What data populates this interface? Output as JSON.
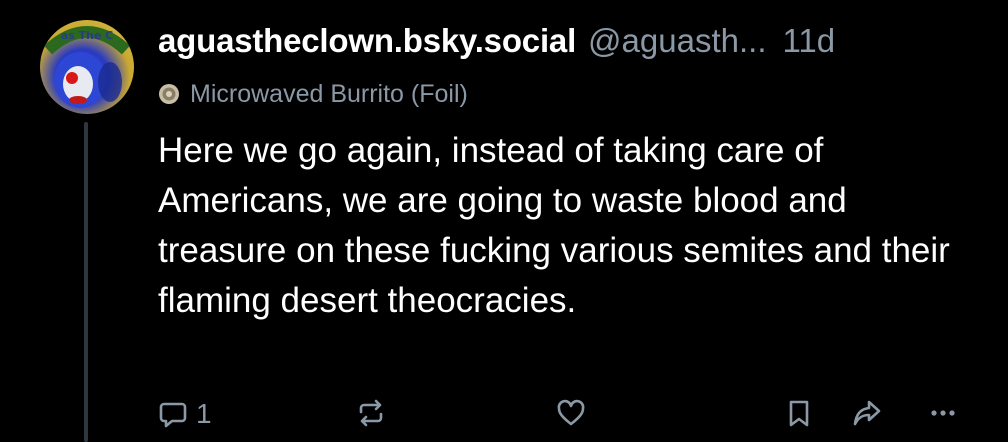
{
  "post": {
    "author": {
      "display_name": "aguastheclown.bsky.social",
      "handle": "@aguasth...",
      "avatar_icon": "clown-avatar-icon",
      "avatar_text": "as The C"
    },
    "age": "11d",
    "badge": {
      "icon": "burrito-badge-icon",
      "label": "Microwaved Burrito (Foil)"
    },
    "text": "Here we go again, instead of taking care of Americans, we are going to waste blood and treasure on these fucking various semites and their flaming desert theocracies.",
    "actions": {
      "reply_count": "1",
      "icons": [
        "reply-icon",
        "repost-icon",
        "like-icon",
        "bookmark-icon",
        "share-icon",
        "more-icon"
      ]
    }
  },
  "colors": {
    "background": "#000000",
    "text_primary": "#ffffff",
    "text_secondary": "#8b98a5",
    "thread_line": "#2e3640"
  }
}
